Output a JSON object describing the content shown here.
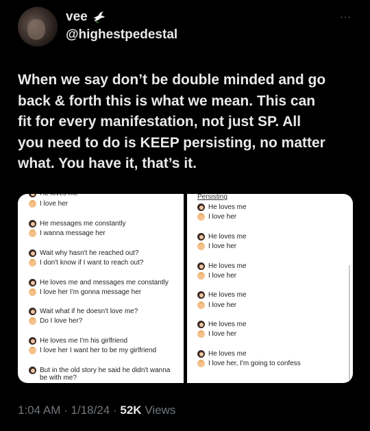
{
  "author": {
    "display_name": "vee",
    "badge_icon": "dove-icon",
    "handle": "@highestpedestal"
  },
  "more_label": "···",
  "tweet": {
    "text": "When we say don’t be double minded and go\nback & forth this is what we mean. This can\nfit for every manifestation, not just SP. All\nyou need to do is KEEP persisting, no matter\nwhat. You have it, that’s it."
  },
  "image_left": {
    "lines": [
      {
        "speaker": "her",
        "text": "He loves me"
      },
      {
        "speaker": "him",
        "text": "I love her"
      },
      {
        "speaker": "her",
        "text": "He messages me constantly"
      },
      {
        "speaker": "him",
        "text": "I wanna message her"
      },
      {
        "speaker": "her",
        "text": "Wait why hasn't he reached out?"
      },
      {
        "speaker": "him",
        "text": "I don't know if I want to reach out?"
      },
      {
        "speaker": "her",
        "text": "He loves me and messages me constantly"
      },
      {
        "speaker": "him",
        "text": "I love her I'm gonna message her"
      },
      {
        "speaker": "her",
        "text": "Wait what if he doesn't love me?"
      },
      {
        "speaker": "him",
        "text": "Do I love her?"
      },
      {
        "speaker": "her",
        "text": "He loves me I'm his girlfriend"
      },
      {
        "speaker": "him",
        "text": "I love her I want her to be my girlfriend"
      },
      {
        "speaker": "her",
        "text": "But in the old story he said he didn't wanna be with me?"
      }
    ]
  },
  "image_right": {
    "heading": "Persisting",
    "lines": [
      {
        "speaker": "her",
        "text": "He loves me"
      },
      {
        "speaker": "him",
        "text": "I love her"
      },
      {
        "speaker": "her",
        "text": "He loves me"
      },
      {
        "speaker": "him",
        "text": "I love her"
      },
      {
        "speaker": "her",
        "text": "He loves me"
      },
      {
        "speaker": "him",
        "text": "I love her"
      },
      {
        "speaker": "her",
        "text": "He loves me"
      },
      {
        "speaker": "him",
        "text": "I love her"
      },
      {
        "speaker": "her",
        "text": "He loves me"
      },
      {
        "speaker": "him",
        "text": "I love her"
      },
      {
        "speaker": "her",
        "text": "He loves me"
      },
      {
        "speaker": "him",
        "text": "I love her, I'm going to confess"
      }
    ]
  },
  "meta": {
    "time": "1:04 AM",
    "date": "1/18/24",
    "views_count": "52K",
    "views_label": "Views",
    "separator": "·"
  }
}
